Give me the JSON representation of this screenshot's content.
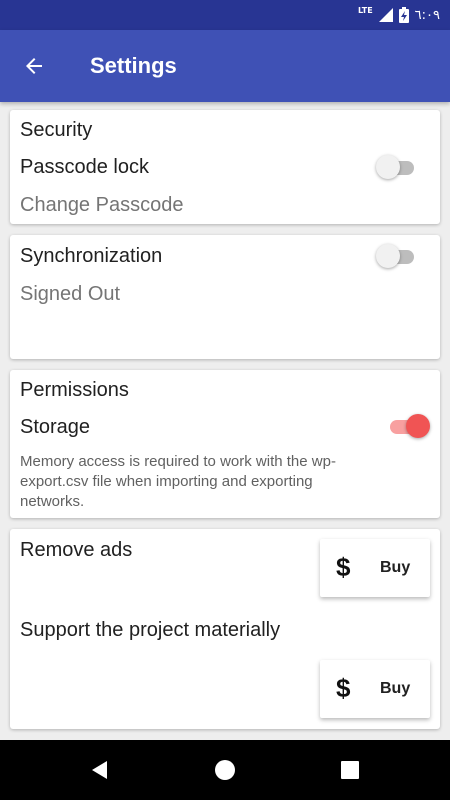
{
  "status_bar": {
    "network": "LTE",
    "time": "٦:٠٩",
    "icons": [
      "signal-icon",
      "battery-charging-icon"
    ]
  },
  "app_bar": {
    "title": "Settings",
    "back_icon": "arrow-back-icon"
  },
  "security": {
    "title": "Security",
    "passcode_lock_label": "Passcode lock",
    "passcode_lock_on": false,
    "change_passcode_label": "Change Passcode"
  },
  "synchronization": {
    "title": "Synchronization",
    "enabled": false,
    "status": "Signed Out"
  },
  "permissions": {
    "title": "Permissions",
    "storage_label": "Storage",
    "storage_on": true,
    "storage_description": "Memory access is required to work with the wp-export.csv file when importing and exporting networks."
  },
  "purchases": {
    "remove_ads_label": "Remove ads",
    "support_label": "Support the project materially",
    "buy_icon": "dollar-icon",
    "buy_symbol": "$",
    "buy_label": "Buy"
  },
  "nav_bar": {
    "icons": [
      "back-triangle-icon",
      "home-circle-icon",
      "recents-square-icon"
    ]
  },
  "colors": {
    "status_bar": "#283593",
    "app_bar": "#3f51b5",
    "switch_on": "#f05454",
    "background": "#eeeeee"
  }
}
